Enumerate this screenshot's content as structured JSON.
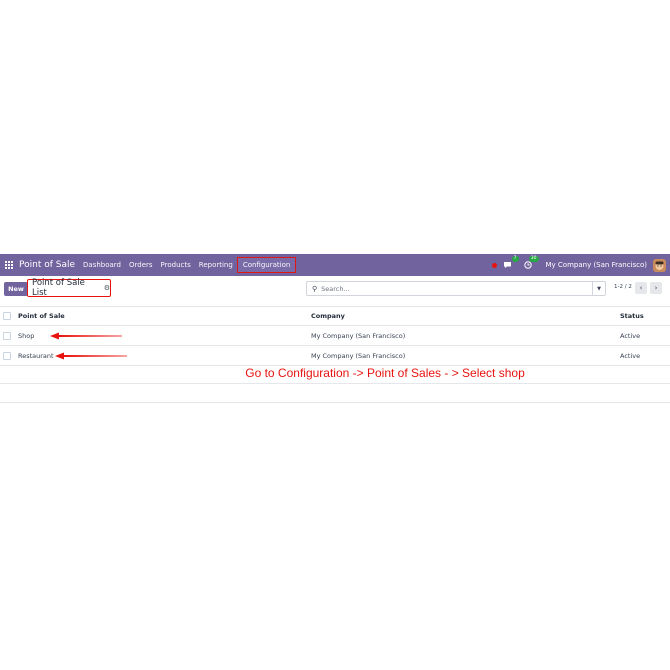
{
  "navbar": {
    "app_title": "Point of Sale",
    "menu": [
      "Dashboard",
      "Orders",
      "Products",
      "Reporting",
      "Configuration"
    ],
    "messages_badge": "7",
    "activities_badge": "30",
    "company": "My Company (San Francisco)",
    "bg_color": "#71639e"
  },
  "control_panel": {
    "new_label": "New",
    "breadcrumb": "Point of Sale List",
    "search_placeholder": "Search...",
    "pager": "1-2 / 2"
  },
  "table": {
    "headers": [
      "Point of Sale",
      "Company",
      "Status"
    ],
    "rows": [
      {
        "name": "Shop",
        "company": "My Company (San Francisco)",
        "status": "Active"
      },
      {
        "name": "Restaurant",
        "company": "My Company (San Francisco)",
        "status": "Active"
      }
    ]
  },
  "annotation": {
    "instruction": "Go to Configuration -> Point of Sales - > Select shop",
    "color": "#e8130f"
  }
}
